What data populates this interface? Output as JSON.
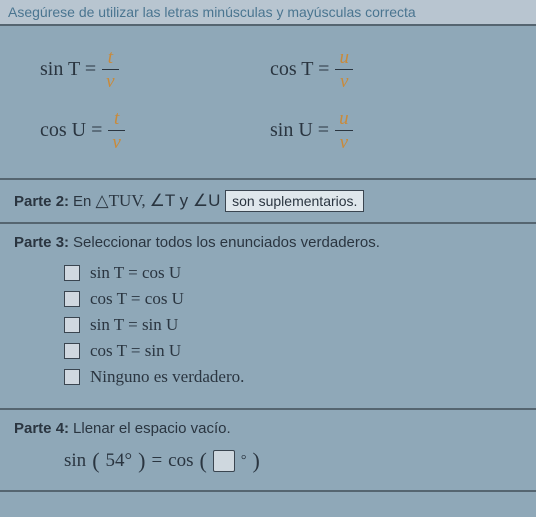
{
  "top_warning": "Asegúrese de utilizar las letras minúsculas y mayúsculas correcta",
  "part1": {
    "eq1": {
      "lhs": "sin T",
      "num": "t",
      "den": "v"
    },
    "eq2": {
      "lhs": "cos T",
      "num": "u",
      "den": "v"
    },
    "eq3": {
      "lhs": "cos U",
      "num": "t",
      "den": "v"
    },
    "eq4": {
      "lhs": "sin U",
      "num": "u",
      "den": "v"
    }
  },
  "part2": {
    "label": "Parte 2:",
    "prefix": "En ",
    "triangle": "△TUV,",
    "angles_text": " ∠T y ∠U ",
    "dropdown_value": "son suplementarios."
  },
  "part3": {
    "label": "Parte 3:",
    "text": "Seleccionar todos los enunciados verdaderos.",
    "options": [
      "sin T = cos U",
      "cos T = cos U",
      "sin T = sin U",
      "cos T = sin U",
      "Ninguno es verdadero."
    ]
  },
  "part4": {
    "label": "Parte 4:",
    "text": "Llenar el espacio vacío.",
    "lhs_func": "sin",
    "lhs_arg": "54°",
    "eq": "=",
    "rhs_func": "cos",
    "rhs_deg": "°"
  }
}
